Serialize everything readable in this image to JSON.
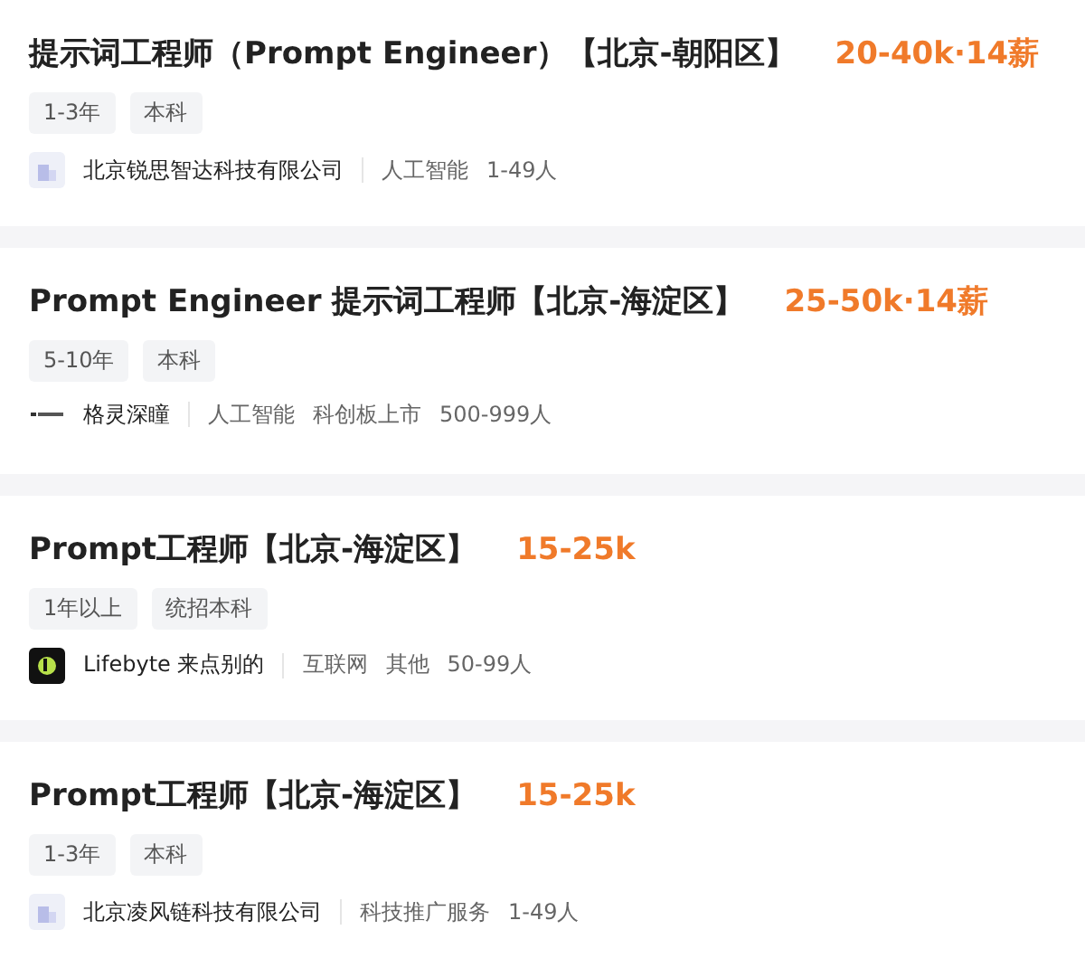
{
  "jobs": [
    {
      "title": "提示词工程师（Prompt Engineer）【北京-朝阳区】",
      "salary": "20-40k·14薪",
      "tags": [
        "1-3年",
        "本科"
      ],
      "company": {
        "kind": "building",
        "name": "北京锐思智达科技有限公司",
        "details": [
          "人工智能",
          "1-49人"
        ]
      }
    },
    {
      "title": "Prompt Engineer 提示词工程师【北京-海淀区】",
      "salary": "25-50k·14薪",
      "tags": [
        "5-10年",
        "本科"
      ],
      "company": {
        "kind": "wordmark",
        "name": "格灵深瞳",
        "details": [
          "人工智能",
          "科创板上市",
          "500-999人"
        ]
      }
    },
    {
      "title": "Prompt工程师【北京-海淀区】",
      "salary": "15-25k",
      "tags": [
        "1年以上",
        "统招本科"
      ],
      "company": {
        "kind": "badge",
        "name": "Lifebyte 来点别的",
        "details": [
          "互联网",
          "其他",
          "50-99人"
        ]
      }
    },
    {
      "title": "Prompt工程师【北京-海淀区】",
      "salary": "15-25k",
      "tags": [
        "1-3年",
        "本科"
      ],
      "company": {
        "kind": "building",
        "name": "北京凌风链科技有限公司",
        "details": [
          "科技推广服务",
          "1-49人"
        ]
      }
    }
  ]
}
